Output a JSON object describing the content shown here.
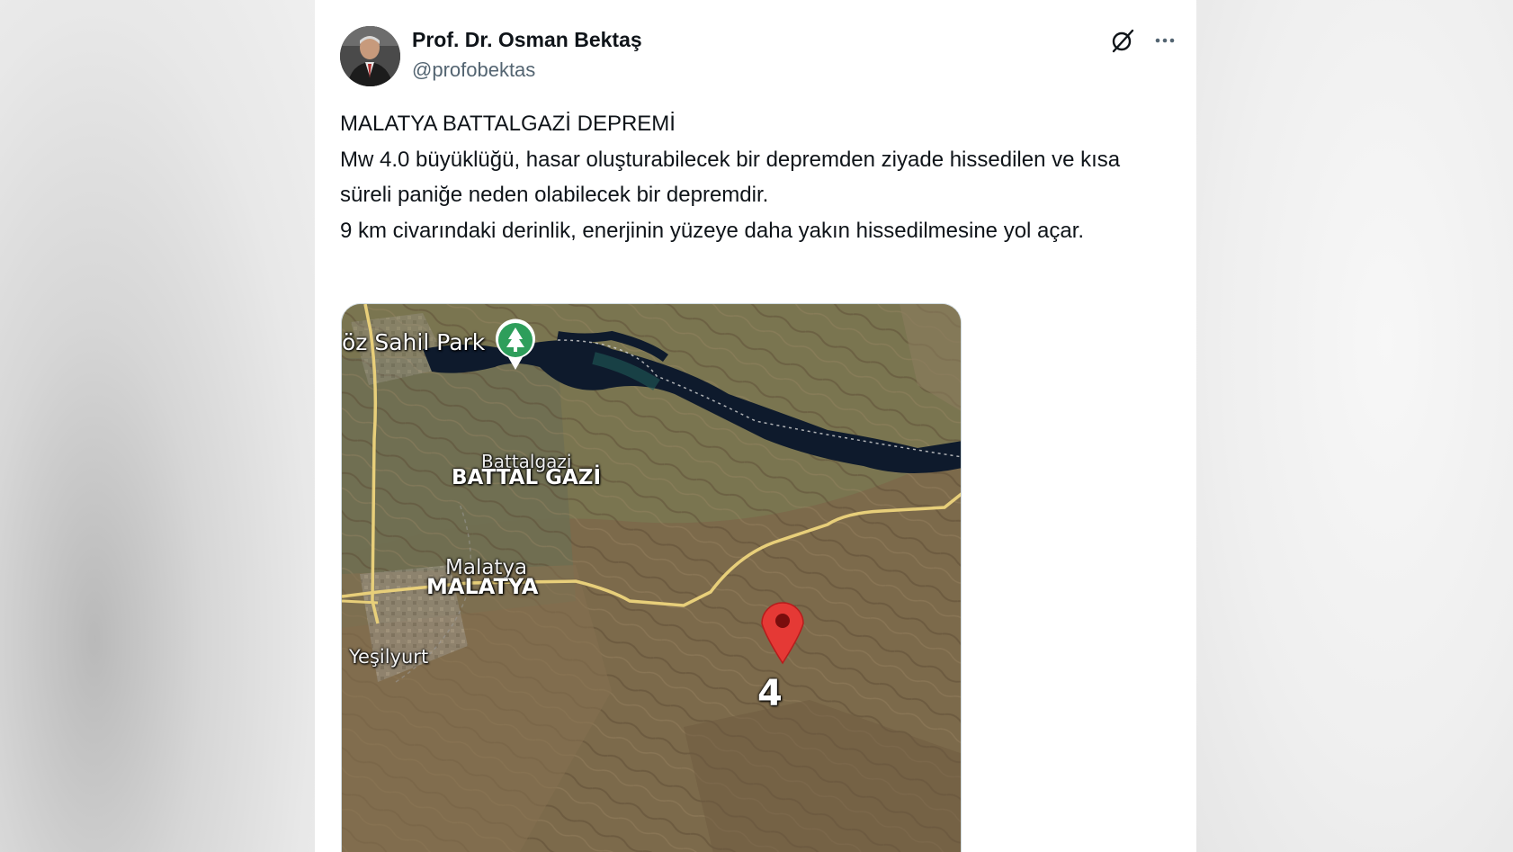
{
  "author": {
    "display_name": "Prof. Dr. Osman Bektaş",
    "handle": "@profobektas"
  },
  "header_icons": [
    "grok-icon",
    "more-options-icon"
  ],
  "tweet": {
    "lines": [
      "MALATYA BATTALGAZİ DEPREMİ",
      "Mw 4.0 büyüklüğü, hasar oluşturabilecek bir depremden ziyade hissedilen ve kısa süreli paniğe neden olabilecek bir depremdir.",
      "9 km civarındaki derinlik, enerjinin yüzeye daha yakın hissedilmesine yol açar."
    ]
  },
  "map": {
    "labels": {
      "park": "öz Sahil Park",
      "battalgazi_small": "Battalgazi",
      "battalgazi": "BATTAL GAZİ",
      "malatya_small": "Malatya",
      "malatya": "MALATYA",
      "yesilyurt": "Yeşilyurt",
      "magnitude": "4"
    },
    "colors": {
      "terrain": "#7a6a4c",
      "lake": "#0f1a2e",
      "road": "#e8cf7a",
      "park_pin": "#2e9e5b",
      "quake_pin": "#e53935"
    }
  }
}
